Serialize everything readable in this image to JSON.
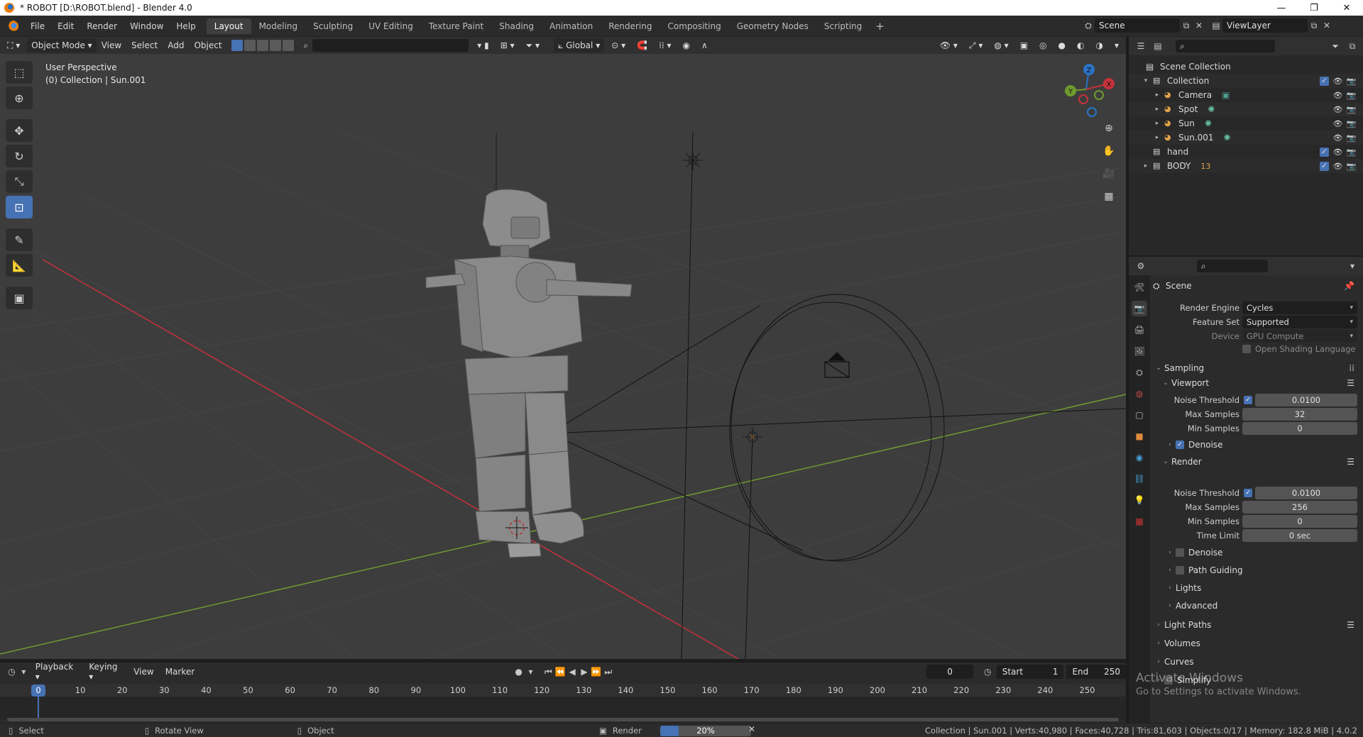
{
  "window": {
    "title": "* ROBOT [D:\\ROBOT.blend] - Blender 4.0",
    "controls": [
      "—",
      "❐",
      "✕"
    ]
  },
  "menu": {
    "items": [
      "File",
      "Edit",
      "Render",
      "Window",
      "Help"
    ],
    "workspaces": [
      "Layout",
      "Modeling",
      "Sculpting",
      "UV Editing",
      "Texture Paint",
      "Shading",
      "Animation",
      "Rendering",
      "Compositing",
      "Geometry Nodes",
      "Scripting"
    ],
    "active_workspace": "Layout",
    "add_workspace": "+",
    "scene": "Scene",
    "view_layer": "ViewLayer"
  },
  "viewport_header": {
    "mode": "Object Mode",
    "menus": [
      "View",
      "Select",
      "Add",
      "Object"
    ],
    "transform_orientation": "Global"
  },
  "viewport": {
    "perspective": "User Perspective",
    "context": "(0) Collection | Sun.001",
    "gizmo": {
      "x": "X",
      "y": "Y",
      "z": "Z"
    },
    "colors": {
      "x_axis": "#c4323c",
      "y_axis": "#6e9b2e",
      "z_axis": "#2a74c7",
      "background": "#3d3d3d",
      "grid": "#474747"
    }
  },
  "toolbar": {
    "tools": [
      "select-box",
      "cursor",
      "move",
      "rotate",
      "scale",
      "transform",
      "annotate",
      "measure",
      "add-cube"
    ],
    "active_tool": "transform"
  },
  "timeline": {
    "menus": [
      "Playback",
      "Keying",
      "View",
      "Marker"
    ],
    "current_frame": "0",
    "start_label": "Start",
    "start": "1",
    "end_label": "End",
    "end": "250",
    "ruler_labels": [
      "0",
      "10",
      "20",
      "30",
      "40",
      "50",
      "60",
      "70",
      "80",
      "90",
      "100",
      "110",
      "120",
      "130",
      "140",
      "150",
      "160",
      "170",
      "180",
      "190",
      "200",
      "210",
      "220",
      "230",
      "240",
      "250"
    ]
  },
  "statusbar": {
    "select": "Select",
    "rotate_view": "Rotate View",
    "object": "Object",
    "render": "Render",
    "render_progress": "20%",
    "render_progress_value": 0.2,
    "stats": "Collection | Sun.001 | Verts:40,980 | Faces:40,728 | Tris:81,603 | Objects:0/17 | Memory: 182.8 MiB | 4.0.2"
  },
  "outliner": {
    "root": "Scene Collection",
    "rows": [
      {
        "name": "Collection",
        "level": 1,
        "icon": "collection",
        "checkbox": true
      },
      {
        "name": "Camera",
        "level": 2,
        "icon": "camera"
      },
      {
        "name": "Spot",
        "level": 2,
        "icon": "light"
      },
      {
        "name": "Sun",
        "level": 2,
        "icon": "light"
      },
      {
        "name": "Sun.001",
        "level": 2,
        "icon": "light"
      },
      {
        "name": "hand",
        "level": 1,
        "icon": "collection",
        "checkbox": true
      },
      {
        "name": "BODY",
        "level": 1,
        "icon": "collection",
        "checkbox": true,
        "badge": "13"
      }
    ]
  },
  "properties": {
    "context": "Scene",
    "render_engine_label": "Render Engine",
    "render_engine": "Cycles",
    "feature_set_label": "Feature Set",
    "feature_set": "Supported",
    "device_label": "Device",
    "device": "GPU Compute",
    "osl_label": "Open Shading Language",
    "sampling": "Sampling",
    "viewport_panel": "Viewport",
    "vp_noise_threshold_label": "Noise Threshold",
    "vp_noise_threshold": "0.0100",
    "vp_max_samples_label": "Max Samples",
    "vp_max_samples": "32",
    "vp_min_samples_label": "Min Samples",
    "vp_min_samples": "0",
    "vp_denoise": "Denoise",
    "render_panel": "Render",
    "r_noise_threshold_label": "Noise Threshold",
    "r_noise_threshold": "0.0100",
    "r_max_samples_label": "Max Samples",
    "r_max_samples": "256",
    "r_min_samples_label": "Min Samples",
    "r_min_samples": "0",
    "r_time_limit_label": "Time Limit",
    "r_time_limit": "0 sec",
    "r_denoise": "Denoise",
    "path_guiding": "Path Guiding",
    "lights": "Lights",
    "advanced": "Advanced",
    "light_paths": "Light Paths",
    "volumes": "Volumes",
    "curves": "Curves",
    "simplify": "Simplify"
  },
  "watermark": {
    "line1": "Activate Windows",
    "line2": "Go to Settings to activate Windows."
  }
}
